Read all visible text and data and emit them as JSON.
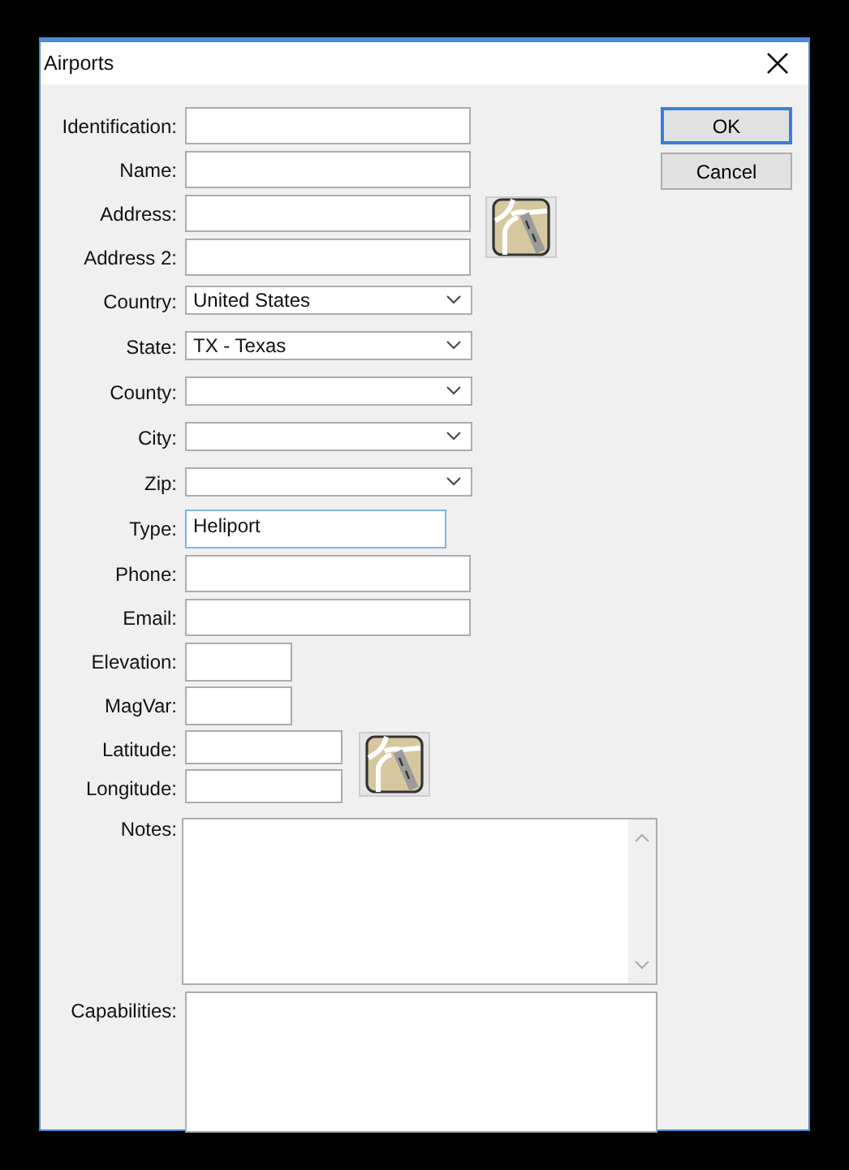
{
  "window": {
    "title": "Airports"
  },
  "fields": [
    {
      "label": "Identification:",
      "kind": "text"
    },
    {
      "label": "Name:",
      "kind": "text"
    },
    {
      "label": "Address:",
      "kind": "text",
      "map_button": true
    },
    {
      "label": "Address 2:",
      "kind": "text"
    },
    {
      "label": "Country:",
      "kind": "combo",
      "value": "United States"
    },
    {
      "label": "State:",
      "kind": "combo",
      "value": "TX - Texas"
    },
    {
      "label": "County:",
      "kind": "combo"
    },
    {
      "label": "City:",
      "kind": "combo"
    },
    {
      "label": "Zip:",
      "kind": "combo"
    },
    {
      "label": "Type:",
      "kind": "type",
      "value": "Heliport",
      "focused": true
    },
    {
      "label": "Phone:",
      "kind": "text"
    },
    {
      "label": "Email:",
      "kind": "text"
    },
    {
      "label": "Elevation:",
      "kind": "short"
    },
    {
      "label": "MagVar:",
      "kind": "short"
    },
    {
      "label": "Latitude:",
      "kind": "coordinate",
      "map_button": true
    },
    {
      "label": "Longitude:",
      "kind": "coordinate"
    },
    {
      "label": "Notes:",
      "kind": "memo",
      "scrollbar": true
    },
    {
      "label": "Capabilities:",
      "kind": "memo2"
    }
  ],
  "buttons": [
    {
      "label": "OK",
      "default": true
    },
    {
      "label": "Cancel",
      "default": false
    }
  ]
}
